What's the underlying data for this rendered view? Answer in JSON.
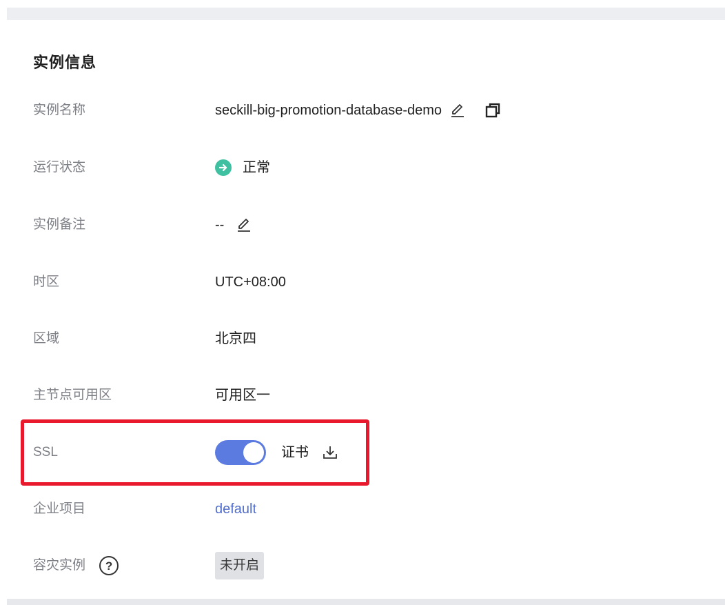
{
  "section": {
    "title": "实例信息"
  },
  "rows": {
    "name": {
      "label": "实例名称",
      "value": "seckill-big-promotion-database-demo",
      "edit_icon": "pencil-icon",
      "copy_icon": "copy-icon"
    },
    "status": {
      "label": "运行状态",
      "value": "正常",
      "icon": "arrow-right-circle-icon",
      "color": "#3fc0a0"
    },
    "remark": {
      "label": "实例备注",
      "value": "--",
      "edit_icon": "pencil-icon"
    },
    "timezone": {
      "label": "时区",
      "value": "UTC+08:00"
    },
    "region": {
      "label": "区域",
      "value": "北京四"
    },
    "az": {
      "label": "主节点可用区",
      "value": "可用区一"
    },
    "ssl": {
      "label": "SSL",
      "enabled": true,
      "cert_label": "证书",
      "download_icon": "download-icon",
      "toggle_color": "#5b7be0"
    },
    "project": {
      "label": "企业项目",
      "value": "default",
      "link_color": "#526ecc"
    },
    "dr": {
      "label": "容灾实例",
      "help_icon": "question-circle-icon",
      "help_glyph": "?",
      "value": "未开启"
    }
  },
  "highlight": {
    "color": "#e8192c"
  }
}
